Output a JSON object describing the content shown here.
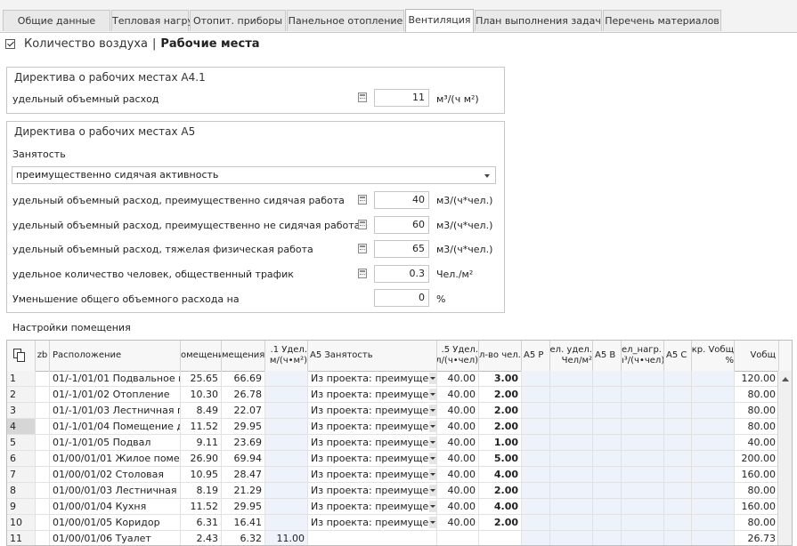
{
  "tabs": [
    {
      "label": "Общие данные",
      "active": false
    },
    {
      "label": "Тепловая нагрузка",
      "active": false
    },
    {
      "label": "Отопит. приборы",
      "active": false
    },
    {
      "label": "Панельное отопление",
      "active": false
    },
    {
      "label": "Вентиляция",
      "active": true
    },
    {
      "label": "План выполнения задач",
      "active": false
    },
    {
      "label": "Перечень материалов",
      "active": false
    }
  ],
  "header": {
    "checkbox_label": "Количество воздуха",
    "separator": "|",
    "bold_title": "Рабочие места",
    "checked": true
  },
  "a41": {
    "title": "Директива о рабочих местах A4.1",
    "label": "удельный объемный расход",
    "value": "11",
    "unit": "м³/(ч м²)"
  },
  "a5": {
    "title": "Директива о рабочих местах A5",
    "occupancy_label": "Занятость",
    "occupancy_value": "преимущественно сидячая активность",
    "rows": [
      {
        "label": "удельный объемный расход, преимущественно сидячая работа",
        "value": "40",
        "unit": "м3/(ч*чел.)",
        "calc": true
      },
      {
        "label": "удельный объемный расход, преимущественно не сидячая работа",
        "value": "60",
        "unit": "м3/(ч*чел.)",
        "calc": true
      },
      {
        "label": "удельный объемный расход, тяжелая физическая работа",
        "value": "65",
        "unit": "м3/(ч*чел.)",
        "calc": true
      },
      {
        "label": "удельное количество человек, общественный трафик",
        "value": "0.3",
        "unit": "Чел./м²",
        "calc": true
      },
      {
        "label": "Уменьшение общего объемного расхода на",
        "value": "0",
        "unit": "%",
        "calc": false
      }
    ]
  },
  "room_settings_label": "Настройки помещения",
  "table": {
    "headers": [
      "",
      "zb",
      "Расположение",
      "омещения",
      "мещения",
      ".1 Удел.\nм/(ч•м²)",
      "A5 Занятость",
      ".5 Удел.\nл/(ч•чел)",
      "л-во чел.",
      "A5 P",
      "ел. удел.\n Чел/м²",
      "A5 B",
      "ел_нагр.\nı³/(ч•чел)",
      "A5 C",
      "кр. Vобщ\n%",
      "Vобщ"
    ],
    "rows": [
      {
        "n": "1",
        "loc": "01/-1/01/01 Подвальное п...",
        "a": "25.65",
        "v": "66.69",
        "a41": "",
        "occ": "Из проекта: преимущес...",
        "a5u": "40.00",
        "ppl": "3.00",
        "vtot": "120.00",
        "selected": false
      },
      {
        "n": "2",
        "loc": "01/-1/01/02 Отопление",
        "a": "10.30",
        "v": "26.78",
        "a41": "",
        "occ": "Из проекта: преимущес...",
        "a5u": "40.00",
        "ppl": "2.00",
        "vtot": "80.00",
        "selected": false
      },
      {
        "n": "3",
        "loc": "01/-1/01/03 Лестничная п...",
        "a": "8.49",
        "v": "22.07",
        "a41": "",
        "occ": "Из проекта: преимущес...",
        "a5u": "40.00",
        "ppl": "2.00",
        "vtot": "80.00",
        "selected": false
      },
      {
        "n": "4",
        "loc": "01/-1/01/04 Помещение д...",
        "a": "11.52",
        "v": "29.95",
        "a41": "",
        "occ": "Из проекта: преимущес...",
        "a5u": "40.00",
        "ppl": "2.00",
        "vtot": "80.00",
        "selected": true
      },
      {
        "n": "5",
        "loc": "01/-1/01/05 Подвал",
        "a": "9.11",
        "v": "23.69",
        "a41": "",
        "occ": "Из проекта: преимущес...",
        "a5u": "40.00",
        "ppl": "1.00",
        "vtot": "40.00",
        "selected": false
      },
      {
        "n": "6",
        "loc": "01/00/01/01 Жилое поме...",
        "a": "26.90",
        "v": "69.94",
        "a41": "",
        "occ": "Из проекта: преимущес...",
        "a5u": "40.00",
        "ppl": "5.00",
        "vtot": "200.00",
        "selected": false
      },
      {
        "n": "7",
        "loc": "01/00/01/02 Столовая",
        "a": "10.95",
        "v": "28.47",
        "a41": "",
        "occ": "Из проекта: преимущес...",
        "a5u": "40.00",
        "ppl": "4.00",
        "vtot": "160.00",
        "selected": false
      },
      {
        "n": "8",
        "loc": "01/00/01/03 Лестничная п...",
        "a": "8.19",
        "v": "21.29",
        "a41": "",
        "occ": "Из проекта: преимущес...",
        "a5u": "40.00",
        "ppl": "2.00",
        "vtot": "80.00",
        "selected": false
      },
      {
        "n": "9",
        "loc": "01/00/01/04 Кухня",
        "a": "11.52",
        "v": "29.95",
        "a41": "",
        "occ": "Из проекта: преимущес...",
        "a5u": "40.00",
        "ppl": "4.00",
        "vtot": "160.00",
        "selected": false
      },
      {
        "n": "10",
        "loc": "01/00/01/05 Коридор",
        "a": "6.31",
        "v": "16.41",
        "a41": "",
        "occ": "Из проекта: преимущес...",
        "a5u": "40.00",
        "ppl": "2.00",
        "vtot": "80.00",
        "selected": false
      },
      {
        "n": "11",
        "loc": "01/00/01/06 Туалет",
        "a": "2.43",
        "v": "6.32",
        "a41": "11.00",
        "occ": "",
        "a5u": "",
        "ppl": "",
        "vtot": "26.73",
        "selected": false
      }
    ]
  }
}
